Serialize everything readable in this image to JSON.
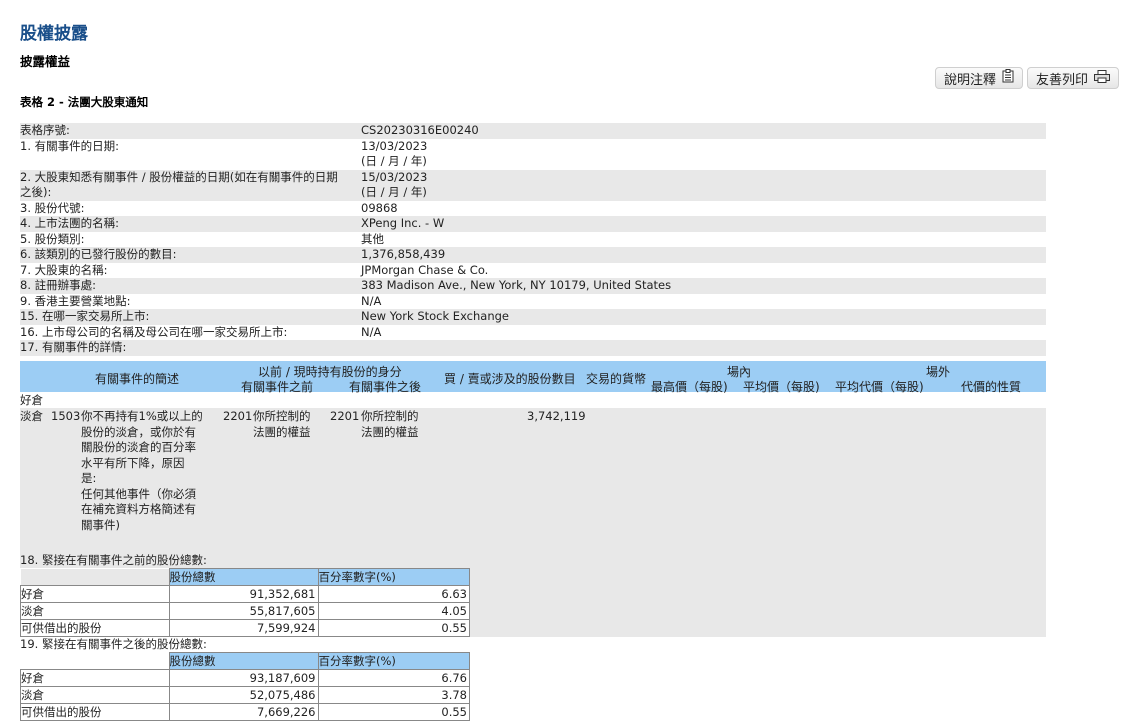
{
  "header": {
    "title": "股權披露",
    "subtitle": "披露權益",
    "form_title": "表格 2 - 法團大股東通知"
  },
  "toolbar": {
    "notes_label": "說明注釋",
    "notes_icon": "clipboard-icon",
    "print_label": "友善列印",
    "print_icon": "printer-icon"
  },
  "fields": [
    {
      "label": "表格序號:",
      "value": "CS20230316E00240"
    },
    {
      "label": "1. 有關事件的日期:",
      "value": "13/03/2023",
      "note": "(日 / 月 / 年)"
    },
    {
      "label": "2. 大股東知悉有關事件 / 股份權益的日期(如在有關事件的日期",
      "label2": "之後):",
      "value": "15/03/2023",
      "note": "(日 / 月 / 年)"
    },
    {
      "label": "3. 股份代號:",
      "value": "09868"
    },
    {
      "label": "4. 上市法團的名稱:",
      "value": "XPeng Inc. - W"
    },
    {
      "label": "5. 股份類別:",
      "value": "其他"
    },
    {
      "label": "6. 該類別的已發行股份的數目:",
      "value": "1,376,858,439"
    },
    {
      "label": "7. 大股東的名稱:",
      "value": "JPMorgan Chase & Co."
    },
    {
      "label": "8. 註冊辦事處:",
      "value": "383 Madison Ave., New York, NY 10179, United States"
    },
    {
      "label": "9. 香港主要營業地點:",
      "value": "N/A"
    },
    {
      "label": "15. 在哪一家交易所上市:",
      "value": "New York Stock Exchange"
    },
    {
      "label": "16. 上市母公司的名稱及母公司在哪一家交易所上市:",
      "value": "N/A"
    },
    {
      "label": "17. 有關事件的詳情:",
      "value": ""
    }
  ],
  "event_table": {
    "headers": {
      "summary": "有關事件的簡述",
      "capacity": "以前 / 現時持有股份的身分",
      "before": "有關事件之前",
      "after": "有關事件之後",
      "shares": "買 / 賣或涉及的股份數目",
      "currency": "交易的貨幣",
      "onex": "場內",
      "high": "最高價（每股)",
      "avg": "平均價（每股)",
      "offex": "場外",
      "avg_off": "平均代價（每股)",
      "nature": "代價的性質"
    },
    "long_label": "好倉",
    "row": {
      "position": "淡倉",
      "code": "1503",
      "desc_lines": [
        "你不再持有1%或以上的",
        "股份的淡倉，或你於有",
        "關股份的淡倉的百分率",
        "水平有所下降，原因",
        "是:",
        "任何其他事件（你必須",
        "在補充資料方格簡述有",
        "關事件)"
      ],
      "before_code": "2201",
      "before_lines": [
        "你所控制的",
        "法團的權益"
      ],
      "after_code": "2201",
      "after_lines": [
        "你所控制的",
        "法團的權益"
      ],
      "shares": "3,742,119"
    }
  },
  "section18": {
    "title": "18. 緊接在有關事件之前的股份總數:",
    "col_total": "股份總數",
    "col_pct": "百分率數字(%)",
    "rows": [
      {
        "label": "好倉",
        "total": "91,352,681",
        "pct": "6.63"
      },
      {
        "label": "淡倉",
        "total": "55,817,605",
        "pct": "4.05"
      },
      {
        "label": "可供借出的股份",
        "total": "7,599,924",
        "pct": "0.55"
      }
    ]
  },
  "section19": {
    "title": "19. 緊接在有關事件之後的股份總數:",
    "col_total": "股份總數",
    "col_pct": "百分率數字(%)",
    "rows": [
      {
        "label": "好倉",
        "total": "93,187,609",
        "pct": "6.76"
      },
      {
        "label": "淡倉",
        "total": "52,075,486",
        "pct": "3.78"
      },
      {
        "label": "可供借出的股份",
        "total": "7,669,226",
        "pct": "0.55"
      }
    ]
  }
}
